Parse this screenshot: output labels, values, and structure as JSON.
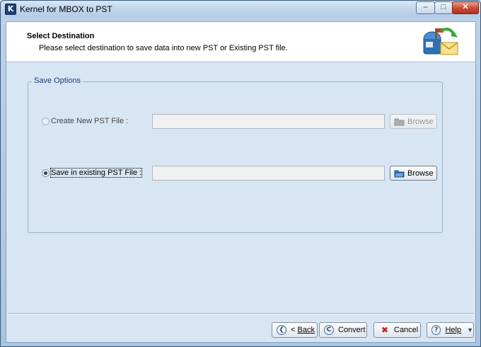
{
  "window": {
    "title": "Kernel for MBOX to PST",
    "app_icon_letter": "K",
    "minimize_glyph": "–",
    "maximize_glyph": "□",
    "close_glyph": "✕"
  },
  "header": {
    "title": "Select Destination",
    "description": "Please select destination to save data into new PST or Existing PST file."
  },
  "save_options": {
    "legend": "Save Options",
    "create_new": {
      "label": "Create New PST File :",
      "selected": false,
      "enabled": false,
      "path_value": "",
      "browse_label": "Browse"
    },
    "existing": {
      "label": "Save in existing PST File :",
      "selected": true,
      "enabled": true,
      "path_value": "",
      "browse_label": "Browse"
    }
  },
  "footer": {
    "back_prefix": "< ",
    "back_label": "Back",
    "convert_label": "Convert",
    "cancel_label": "Cancel",
    "help_label": "Help"
  },
  "icons": {
    "app": "app-k-icon",
    "header": "mailbox-envelope-icon",
    "folder": "folder-icon",
    "back": "back-arrow-icon",
    "convert": "convert-icon",
    "cancel": "cancel-x-icon",
    "help": "question-icon",
    "dropdown": "chevron-down-icon"
  },
  "colors": {
    "client_bg": "#d8e6f3",
    "legend_text": "#1c3a7a",
    "close_red": "#c94a33",
    "cancel_red": "#c0201a"
  }
}
